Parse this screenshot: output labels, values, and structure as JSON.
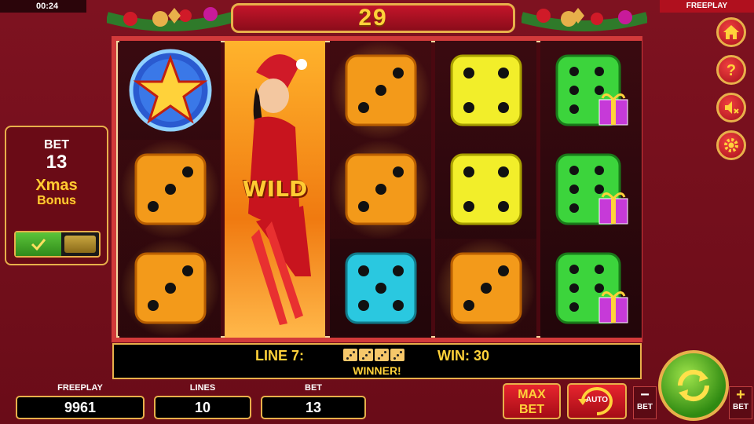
{
  "top": {
    "clock": "00:24",
    "mode": "FREEPLAY",
    "counter": "29"
  },
  "side_buttons": [
    "home-icon",
    "help-icon",
    "sound-off-icon",
    "settings-icon"
  ],
  "bet_panel": {
    "label": "BET",
    "value": "13",
    "bonus_line1": "Xmas",
    "bonus_line2": "Bonus"
  },
  "reels": {
    "wild_label": "WILD",
    "grid": [
      [
        "star",
        "dice-3-orange",
        "dice-3-orange"
      ],
      [
        "wild-santa",
        "wild-santa",
        "wild-santa"
      ],
      [
        "dice-3-orange",
        "dice-3-orange",
        "dice-5-cyan"
      ],
      [
        "dice-4-yellow",
        "dice-4-yellow",
        "dice-3-orange"
      ],
      [
        "dice-6-green",
        "dice-6-green",
        "dice-6-green"
      ]
    ]
  },
  "win_info": {
    "line": "LINE 7:",
    "win": "WIN: 30",
    "winner": "WINNER!"
  },
  "stats": {
    "freeplay_label": "FREEPLAY",
    "freeplay_value": "9961",
    "lines_label": "LINES",
    "lines_value": "10",
    "bet_label": "BET",
    "bet_value": "13"
  },
  "controls": {
    "max_bet_1": "MAX",
    "max_bet_2": "BET",
    "auto": "AUTO",
    "bet_minus": "BET",
    "bet_plus": "BET"
  },
  "colors": {
    "frame": "#e8b04a",
    "background": "#7a0f1c",
    "accent": "#ffd23a"
  }
}
